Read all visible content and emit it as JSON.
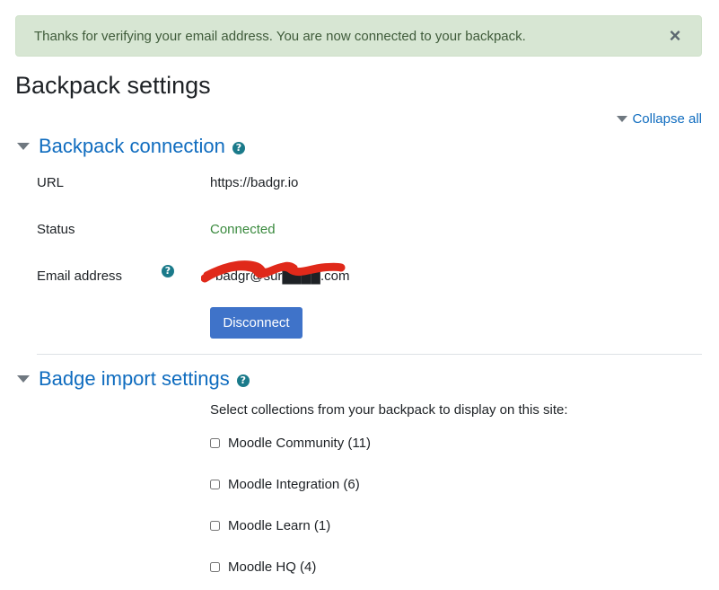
{
  "alert": {
    "message": "Thanks for verifying your email address. You are now connected to your backpack.",
    "close": "×"
  },
  "page": {
    "title": "Backpack settings",
    "collapse_all": "Collapse all"
  },
  "connection": {
    "heading": "Backpack connection",
    "url_label": "URL",
    "url_value": "https://badgr.io",
    "status_label": "Status",
    "status_value": "Connected",
    "email_label": "Email address",
    "email_value": "badgr@sur████.com",
    "disconnect": "Disconnect"
  },
  "import": {
    "heading": "Badge import settings",
    "instructions": "Select collections from your backpack to display on this site:",
    "collections": [
      {
        "label": "Moodle Community (11)"
      },
      {
        "label": "Moodle Integration (6)"
      },
      {
        "label": "Moodle Learn (1)"
      },
      {
        "label": "Moodle HQ (4)"
      }
    ]
  },
  "icons": {
    "help": "question-circle-icon",
    "collapse": "caret-down-icon"
  },
  "colors": {
    "link": "#0f6cbf",
    "success": "#3a8a3e",
    "button": "#3f73c9",
    "alert_bg": "#d7e6d3",
    "redaction": "#e0291a"
  }
}
